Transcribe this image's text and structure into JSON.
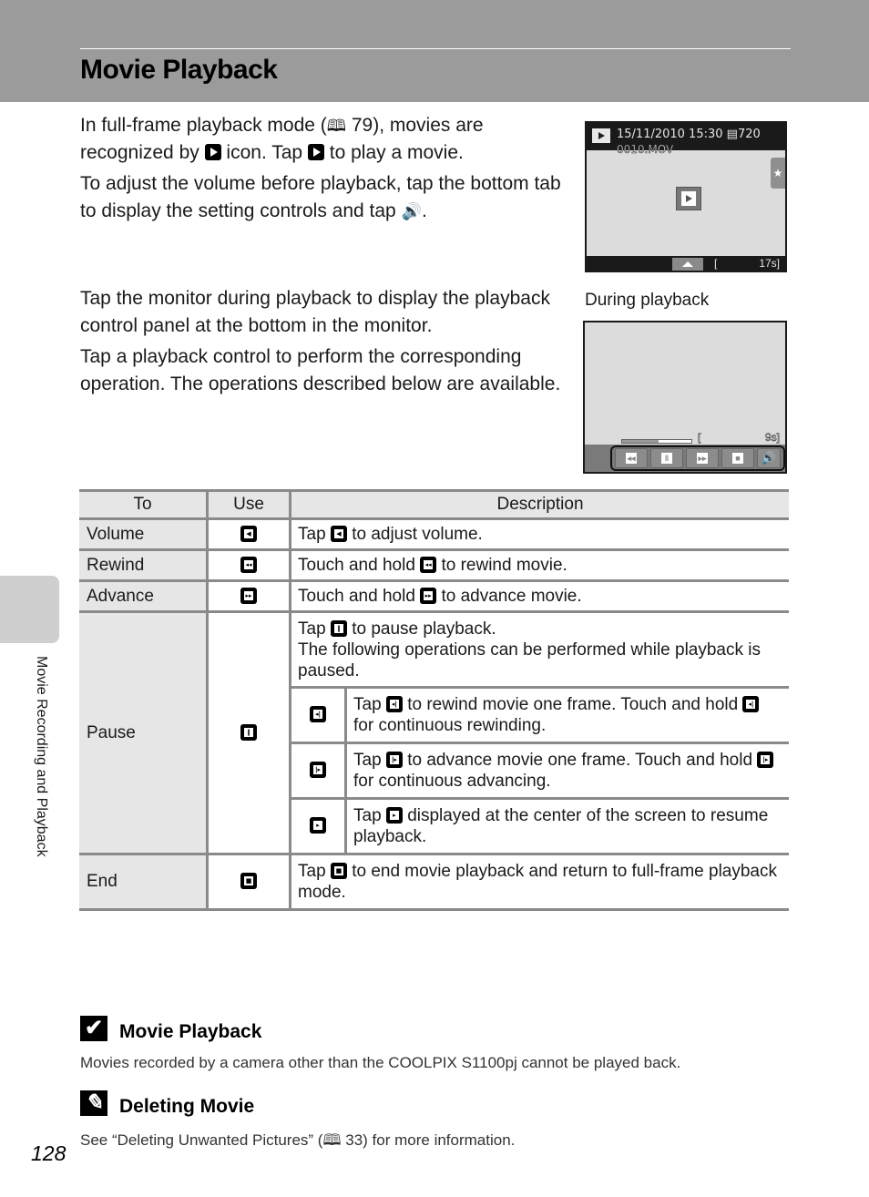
{
  "header": {
    "title": "Movie Playback",
    "band_color": "#9b9b9b"
  },
  "side_tab": {
    "label": "Movie Recording and Playback"
  },
  "intro": {
    "p1_a": "In full-frame playback mode (",
    "p1_ref": "79",
    "p1_b": "), movies are recognized by ",
    "p1_c": " icon. Tap ",
    "p1_d": " to play a movie.",
    "p2_a": "To adjust the volume before playback, tap the bottom tab to display the setting controls and tap ",
    "p2_b": ".",
    "p3": "Tap the monitor during playback to display the playback control panel at the bottom in the monitor.",
    "p4": "Tap a playback control to perform the corresponding operation. The operations described below are available."
  },
  "screen1": {
    "datetime": "15/11/2010  15:30",
    "quality": "720",
    "filename": "0010.MOV",
    "time_open": "[",
    "time_remaining": "17s]",
    "star": "★"
  },
  "screen2": {
    "caption": "During playback",
    "progress": 0.53,
    "time_open": "[",
    "time_remaining": "9s]",
    "controls": [
      "rewind",
      "pause",
      "advance",
      "stop",
      "volume"
    ]
  },
  "table": {
    "headers": {
      "to": "To",
      "use": "Use",
      "description": "Description"
    },
    "rows": {
      "volume": {
        "to": "Volume",
        "icon": "volume-icon",
        "desc_a": "Tap ",
        "desc_b": " to adjust volume."
      },
      "rewind": {
        "to": "Rewind",
        "icon": "rewind-icon",
        "desc_a": "Touch and hold ",
        "desc_b": " to rewind movie."
      },
      "advance": {
        "to": "Advance",
        "icon": "advance-icon",
        "desc_a": "Touch and hold ",
        "desc_b": " to advance movie."
      },
      "pause": {
        "to": "Pause",
        "icon": "pause-icon",
        "desc_a": "Tap ",
        "desc_b": " to pause playback.",
        "desc_c": "The following operations can be performed while playback is paused.",
        "sub": {
          "frame_back": {
            "a": "Tap ",
            "b": " to rewind movie one frame. Touch and hold ",
            "c": " for continuous rewinding."
          },
          "frame_fwd": {
            "a": "Tap ",
            "b": " to advance movie one frame. Touch and hold ",
            "c": " for continuous advancing."
          },
          "resume": {
            "a": "Tap ",
            "b": " displayed at the center of the screen to resume playback."
          }
        }
      },
      "end": {
        "to": "End",
        "icon": "stop-icon",
        "desc_a": "Tap ",
        "desc_b": " to end movie playback and return to full-frame playback mode."
      }
    }
  },
  "notes": {
    "caution_title": "Movie Playback",
    "caution_body": "Movies recorded by a camera other than the COOLPIX S1100pj cannot be played back.",
    "info_title": "Deleting Movie",
    "info_body_a": "See “Deleting Unwanted Pictures” (",
    "info_ref": "33",
    "info_body_b": ") for more information."
  },
  "page_number": "128"
}
